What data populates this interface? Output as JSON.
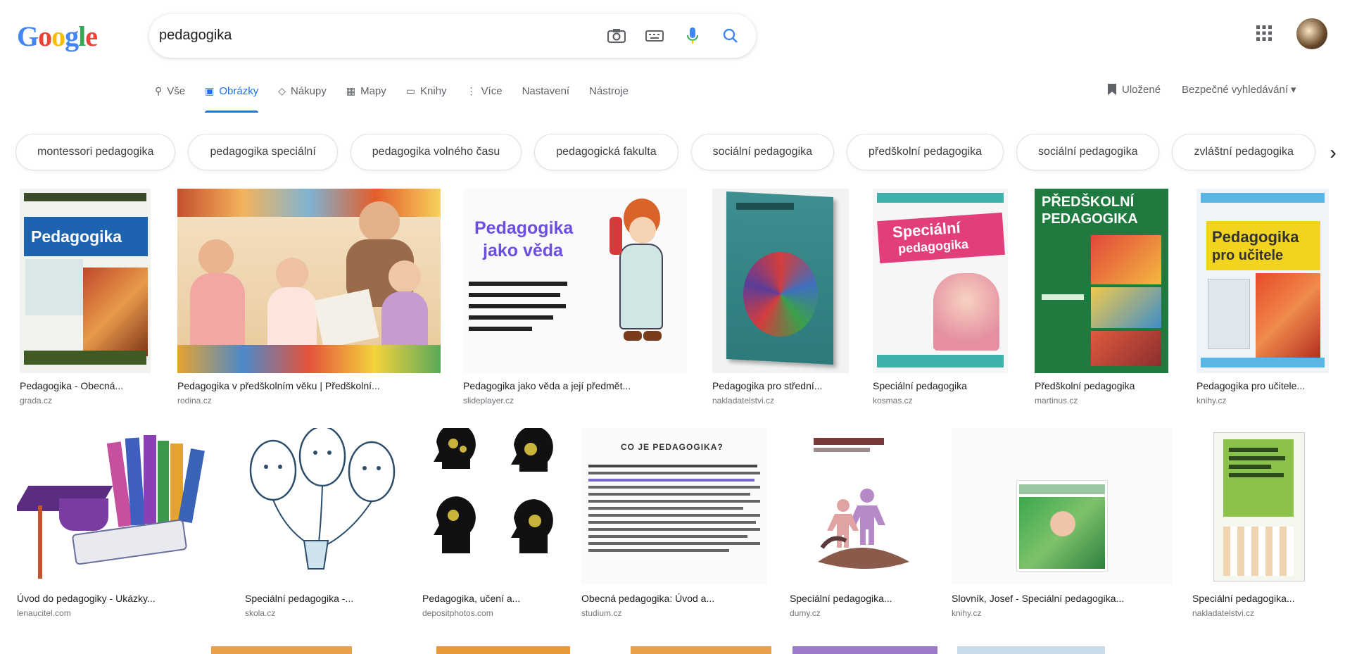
{
  "search": {
    "query": "pedagogika"
  },
  "logo": {
    "text": "Google"
  },
  "tabs": [
    {
      "label": "Vše",
      "icon": "search-icon"
    },
    {
      "label": "Obrázky",
      "icon": "image-icon",
      "active": true
    },
    {
      "label": "Nákupy",
      "icon": "tag-icon"
    },
    {
      "label": "Mapy",
      "icon": "map-icon"
    },
    {
      "label": "Knihy",
      "icon": "book-icon"
    },
    {
      "label": "Více",
      "icon": "more-icon"
    },
    {
      "label": "Nastavení"
    },
    {
      "label": "Nástroje"
    }
  ],
  "tools_right": {
    "saved": "Uložené",
    "safe": "Bezpečné vyhledávání"
  },
  "chips": [
    "montessori pedagogika",
    "pedagogika speciální",
    "pedagogika volného času",
    "pedagogická fakulta",
    "sociální pedagogika",
    "předškolní pedagogika",
    "sociální pedagogika",
    "zvláštní pedagogika"
  ],
  "row1": [
    {
      "title": "Pedagogika - Obecná...",
      "source": "grada.cz"
    },
    {
      "title": "Pedagogika v předškolním věku | Předškolní...",
      "source": "rodina.cz"
    },
    {
      "title": "Pedagogika jako věda a její předmět...",
      "source": "slideplayer.cz"
    },
    {
      "title": "Pedagogika pro střední...",
      "source": "nakladatelstvi.cz"
    },
    {
      "title": "Speciální pedagogika",
      "source": "kosmas.cz"
    },
    {
      "title": "Předškolní pedagogika",
      "source": "martinus.cz"
    },
    {
      "title": "Pedagogika pro učitele...",
      "source": "knihy.cz"
    }
  ],
  "row1_images": {
    "c1": {
      "line": "Pedagogika"
    },
    "c3": {
      "line1": "Pedagogika",
      "line2": "jako věda"
    },
    "c5": {
      "line1": "Speciální",
      "line2": "pedagogika"
    },
    "c6": {
      "line1": "PŘEDŠKOLNÍ",
      "line2": "PEDAGOGIKA"
    },
    "c7": {
      "line1": "Pedagogika",
      "line2": "pro učitele"
    }
  },
  "row2": [
    {
      "title": "Úvod do pedagogiky - Ukázky...",
      "source": "lenaucitel.com"
    },
    {
      "title": "Speciální pedagogika -...",
      "source": "skola.cz"
    },
    {
      "title": "Pedagogika, učení a...",
      "source": "depositphotos.com"
    },
    {
      "title": "Obecná pedagogika: Úvod a...",
      "source": "studium.cz"
    },
    {
      "title": "Speciální pedagogika...",
      "source": "dumy.cz"
    },
    {
      "title": "Slovník, Josef - Speciální pedagogika...",
      "source": "knihy.cz"
    },
    {
      "title": "Speciální pedagogika...",
      "source": "nakladatelstvi.cz"
    }
  ],
  "row2_images": {
    "c4": {
      "heading": "CO JE PEDAGOGIKA?"
    }
  },
  "colors": {
    "accent": "#1a73e8"
  }
}
